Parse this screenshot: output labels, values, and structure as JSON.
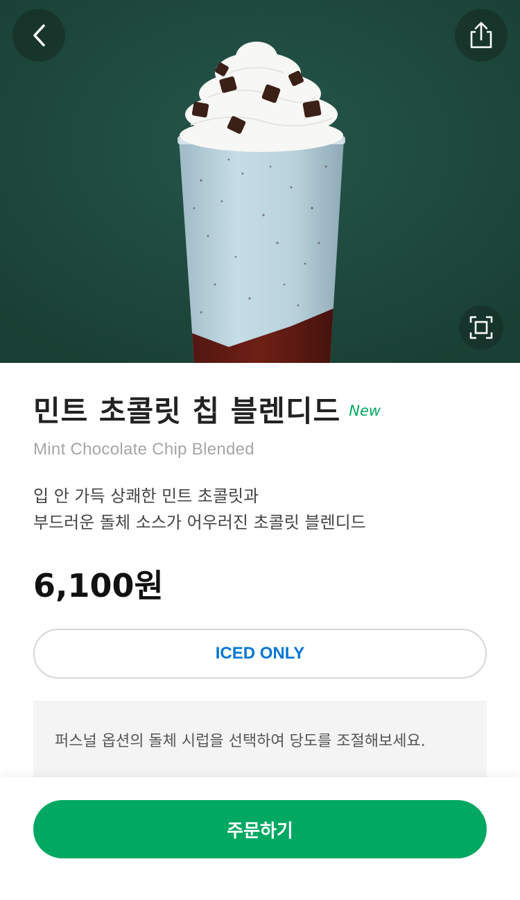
{
  "product": {
    "name_ko": "민트 초콜릿 칩 블렌디드",
    "badge": "New",
    "name_en": "Mint Chocolate Chip Blended",
    "description_lines": [
      "입 안 가득 상쾌한 민트 초콜릿과",
      "부드러운 돌체 소스가 어우러진 초콜릿 블렌디드"
    ],
    "price": "6,100원",
    "temperature_option": "ICED ONLY",
    "notice": "퍼스널 옵션의 돌체 시럽을 선택하여 당도를 조절해보세요."
  },
  "actions": {
    "order_label": "주문하기"
  },
  "icons": {
    "back": "chevron-left-icon",
    "share": "share-icon",
    "zoom": "expand-image-icon"
  },
  "colors": {
    "hero_background": "#1f4a3c",
    "brand_green": "#00a862",
    "option_blue": "#0075d2"
  }
}
